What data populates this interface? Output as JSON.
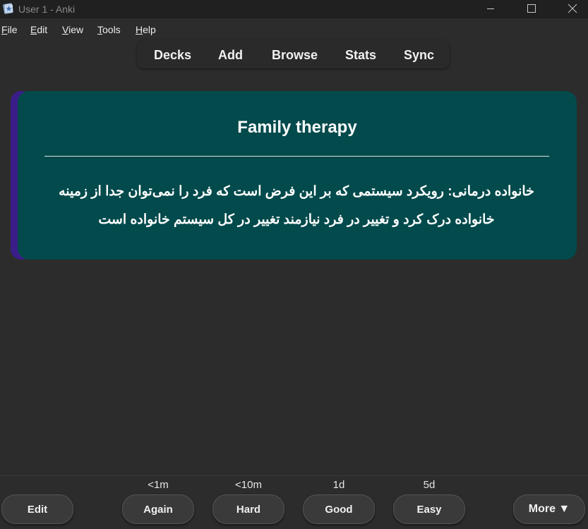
{
  "window": {
    "title": "User 1 - Anki"
  },
  "menu": [
    "File",
    "Edit",
    "View",
    "Tools",
    "Help"
  ],
  "nav": [
    "Decks",
    "Add",
    "Browse",
    "Stats",
    "Sync"
  ],
  "card": {
    "front": "Family therapy",
    "back": "خانواده درمانی: رویکرد سیستمی که بر این فرض است که فرد را نمی‌توان جدا از زمینه خانواده درک کرد و تغییر در فرد نیازمند تغییر در کل سیستم خانواده است",
    "colors": {
      "card_bg": "#024a4c",
      "edge": "#3b1d8a"
    }
  },
  "bottom": {
    "edit_label": "Edit",
    "answers": [
      {
        "label": "Again",
        "interval": "<1m"
      },
      {
        "label": "Hard",
        "interval": "<10m"
      },
      {
        "label": "Good",
        "interval": "1d"
      },
      {
        "label": "Easy",
        "interval": "5d"
      }
    ],
    "more_label": "More ▼"
  }
}
